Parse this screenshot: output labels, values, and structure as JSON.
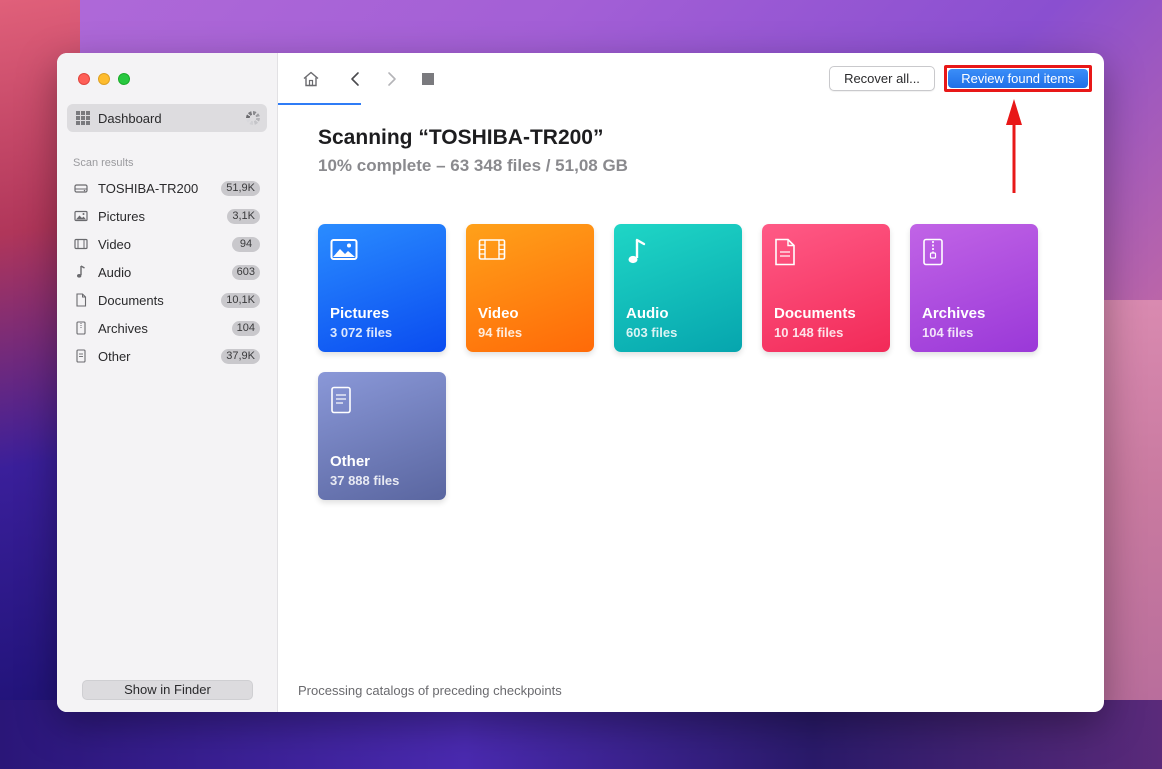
{
  "sidebar": {
    "dashboard_label": "Dashboard",
    "scan_results_header": "Scan results",
    "items": [
      {
        "label": "TOSHIBA-TR200",
        "count": "51,9K",
        "icon": "drive-icon"
      },
      {
        "label": "Pictures",
        "count": "3,1K",
        "icon": "picture-icon"
      },
      {
        "label": "Video",
        "count": "94",
        "icon": "film-icon"
      },
      {
        "label": "Audio",
        "count": "603",
        "icon": "music-note-icon"
      },
      {
        "label": "Documents",
        "count": "10,1K",
        "icon": "document-icon"
      },
      {
        "label": "Archives",
        "count": "104",
        "icon": "archive-icon"
      },
      {
        "label": "Other",
        "count": "37,9K",
        "icon": "other-file-icon"
      }
    ],
    "show_in_finder_label": "Show in Finder"
  },
  "toolbar": {
    "recover_all_label": "Recover all...",
    "review_found_label": "Review found items"
  },
  "main": {
    "title": "Scanning “TOSHIBA-TR200”",
    "subtitle": "10% complete – 63 348 files / 51,08 GB",
    "tiles": [
      {
        "name": "Pictures",
        "count": "3 072 files",
        "icon": "picture-icon"
      },
      {
        "name": "Video",
        "count": "94 files",
        "icon": "film-icon"
      },
      {
        "name": "Audio",
        "count": "603 files",
        "icon": "music-note-icon"
      },
      {
        "name": "Documents",
        "count": "10 148 files",
        "icon": "document-icon"
      },
      {
        "name": "Archives",
        "count": "104 files",
        "icon": "archive-icon"
      },
      {
        "name": "Other",
        "count": "37 888 files",
        "icon": "other-file-icon"
      }
    ],
    "status_text": "Processing catalogs of preceding checkpoints"
  },
  "colors": {
    "accent": "#2f7cf6",
    "highlight_red": "#e81818",
    "pictures": "#1a66f8",
    "video": "#ff8510",
    "audio": "#10bdb8",
    "documents": "#f8416e",
    "archives": "#ad4ede",
    "other": "#717dbc"
  }
}
